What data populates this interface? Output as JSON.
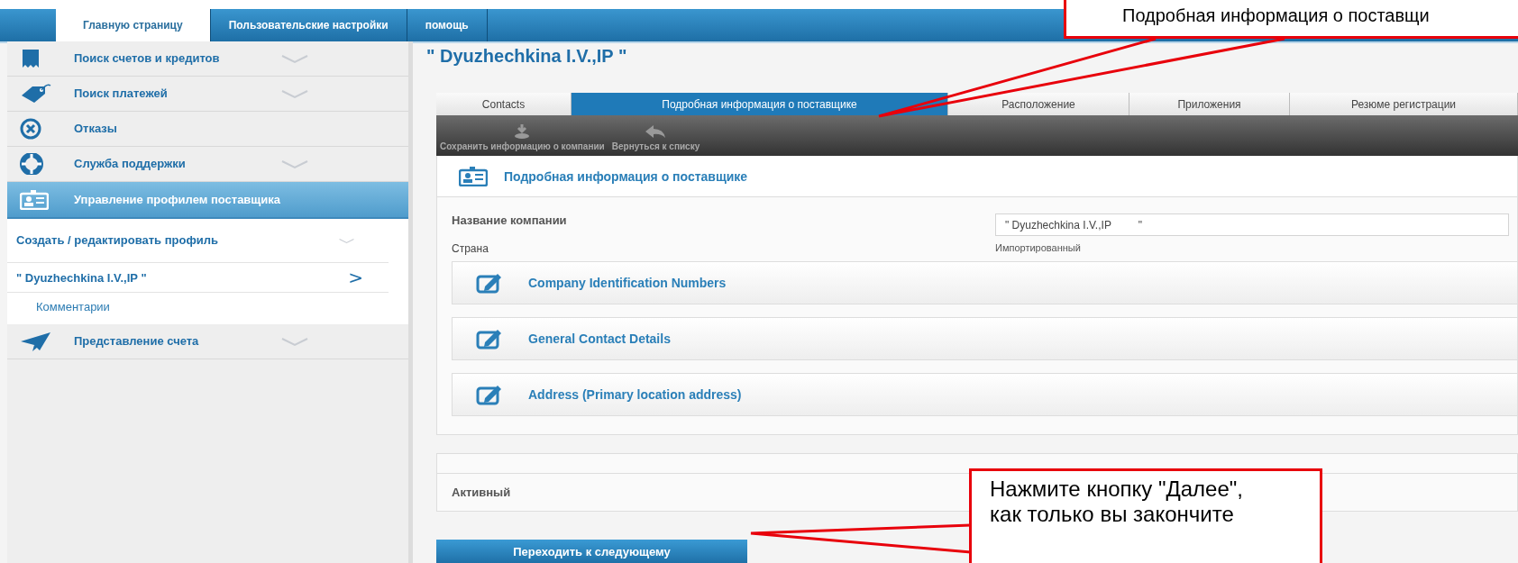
{
  "top_nav": {
    "tabs": [
      {
        "label": "Главную страницу",
        "selected": true
      },
      {
        "label": "Пользовательские настройки",
        "selected": false
      },
      {
        "label": "помощь",
        "selected": false
      }
    ]
  },
  "sidebar": {
    "items": [
      {
        "label": "Поиск счетов и кредитов",
        "selected": false,
        "expandable": true
      },
      {
        "label": "Поиск платежей",
        "selected": false,
        "expandable": true
      },
      {
        "label": "Отказы",
        "selected": false,
        "expandable": false
      },
      {
        "label": "Служба поддержки",
        "selected": false,
        "expandable": true
      },
      {
        "label": "Управление профилем поставщика",
        "selected": true,
        "expandable": false,
        "children": [
          {
            "label": "Создать / редактировать профиль",
            "kind": "group"
          },
          {
            "label": "\" Dyuzhechkina I.V.,IP \"",
            "kind": "current",
            "marker": ">"
          },
          {
            "label": "Комментарии",
            "kind": "leaf"
          }
        ]
      },
      {
        "label": "Представление счета",
        "selected": false,
        "expandable": true
      }
    ]
  },
  "page_title": "\" Dyuzhechkina I.V.,IP \"",
  "tabs": [
    {
      "label": "Contacts",
      "selected": false
    },
    {
      "label": "Подробная информация о поставщике",
      "selected": true
    },
    {
      "label": "Расположение",
      "selected": false
    },
    {
      "label": "Приложения",
      "selected": false
    },
    {
      "label": "Резюме регистрации",
      "selected": false
    }
  ],
  "toolbar": [
    {
      "label": "Сохранить информацию о компании",
      "kind": "save"
    },
    {
      "label": "Вернуться к списку",
      "kind": "back"
    }
  ],
  "panel": {
    "title": "Подробная информация о поставщике",
    "company_name": {
      "label": "Название компании",
      "value": "\" Dyuzhechkina I.V.,IP         \""
    },
    "country": {
      "label": "Страна",
      "note": "Импортированный"
    },
    "sections": [
      {
        "label": "Company Identification Numbers"
      },
      {
        "label": "General Contact Details"
      },
      {
        "label": "Address (Primary location address)"
      }
    ]
  },
  "status_panel": {
    "label": "Активный"
  },
  "next_button": "Переходить к следующему",
  "callouts": [
    {
      "text": "Подробная информация о поставщи"
    },
    {
      "text": "Нажмите кнопку \"Далее\", как только вы закончите"
    }
  ]
}
